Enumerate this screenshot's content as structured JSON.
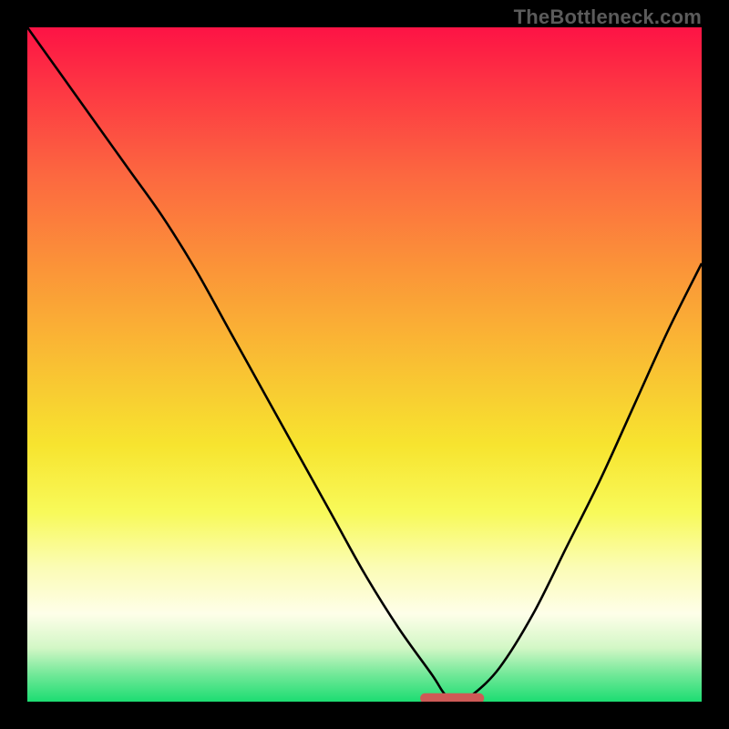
{
  "watermark": "TheBottleneck.com",
  "chart_data": {
    "type": "line",
    "title": "",
    "xlabel": "",
    "ylabel": "",
    "xlim": [
      0,
      100
    ],
    "ylim": [
      0,
      100
    ],
    "grid": false,
    "series": [
      {
        "name": "bottleneck-curve",
        "x": [
          0,
          5,
          10,
          15,
          20,
          25,
          30,
          35,
          40,
          45,
          50,
          55,
          60,
          62,
          64,
          66,
          70,
          75,
          80,
          85,
          90,
          95,
          100
        ],
        "values": [
          100,
          93,
          86,
          79,
          72,
          64,
          55,
          46,
          37,
          28,
          19,
          11,
          4,
          1,
          0,
          1,
          5,
          13,
          23,
          33,
          44,
          55,
          65
        ]
      }
    ],
    "marker": {
      "x_start": 59,
      "x_end": 67,
      "y": 0.5,
      "color": "#ce5a56"
    },
    "background_gradient": {
      "top": "#fd1345",
      "bottom": "#1cdd72"
    }
  }
}
